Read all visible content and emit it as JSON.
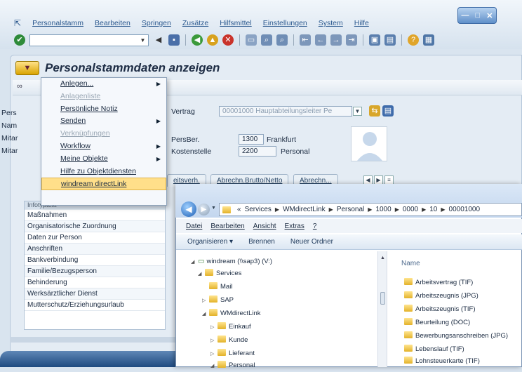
{
  "menubar": {
    "items": [
      "Personalstamm",
      "Bearbeiten",
      "Springen",
      "Zusätze",
      "Hilfsmittel",
      "Einstellungen",
      "System",
      "Hilfe"
    ]
  },
  "window_controls": {
    "min": "—",
    "max": "□",
    "close": "✕"
  },
  "title": "Personalstammdaten anzeigen",
  "left_labels": [
    "Pers",
    "Nam",
    "Mitar",
    "Mitar"
  ],
  "fields": {
    "vertrag_label": "Vertrag",
    "vertrag_value": "00001000 Hauptabteilungsleiter Pe",
    "persber_label": "PersBer.",
    "persber_code": "1300",
    "persber_text": "Frankfurt",
    "kostenstelle_label": "Kostenstelle",
    "kostenstelle_code": "2200",
    "kostenstelle_text": "Personal"
  },
  "tabs": [
    "eitsverh.",
    "Abrechn.Brutto/Netto",
    "Abrechn..."
  ],
  "context_menu": {
    "items": [
      {
        "label": "Anlegen...",
        "arrow": "▶"
      },
      {
        "label": "Anlagenliste"
      },
      {
        "label": "Persönliche Notiz"
      },
      {
        "label": "Senden",
        "arrow": "▶"
      },
      {
        "label": "Verknüpfungen"
      },
      {
        "label": "Workflow",
        "arrow": "▶"
      },
      {
        "label": "Meine Objekte",
        "arrow": "▶"
      },
      {
        "label": "Hilfe zu Objektdiensten"
      },
      {
        "label": "windream directLink"
      }
    ]
  },
  "infotypes": {
    "header": "Infotyptext",
    "rows": [
      "Maßnahmen",
      "Organisatorische Zuordnung",
      "Daten zur Person",
      "Anschriften",
      "Bankverbindung",
      "Familie/Bezugsperson",
      "Behinderung",
      "Werksärztlicher Dienst",
      "Mutterschutz/Erziehungsurlaub"
    ]
  },
  "explorer": {
    "breadcrumb": [
      "«",
      "Services",
      "WMdirectLink",
      "Personal",
      "1000",
      "0000",
      "10",
      "00001000"
    ],
    "menu": [
      "Datei",
      "Bearbeiten",
      "Ansicht",
      "Extras",
      "?"
    ],
    "commands": [
      "Organisieren ▾",
      "Brennen",
      "Neuer Ordner"
    ],
    "tree": [
      "windream (\\\\sap3) (V:)",
      "Services",
      "Mail",
      "SAP",
      "WMdirectLink",
      "Einkauf",
      "Kunde",
      "Lieferant",
      "Personal"
    ],
    "column_name": "Name",
    "files": [
      "Arbeitsvertrag (TIF)",
      "Arbeitszeugnis (JPG)",
      "Arbeitszeugnis (TIF)",
      "Beurteilung (DOC)",
      "Bewerbungsanschreiben (JPG)",
      "Lebenslauf (TIF)",
      "Lohnsteuerkarte (TIF)"
    ]
  }
}
